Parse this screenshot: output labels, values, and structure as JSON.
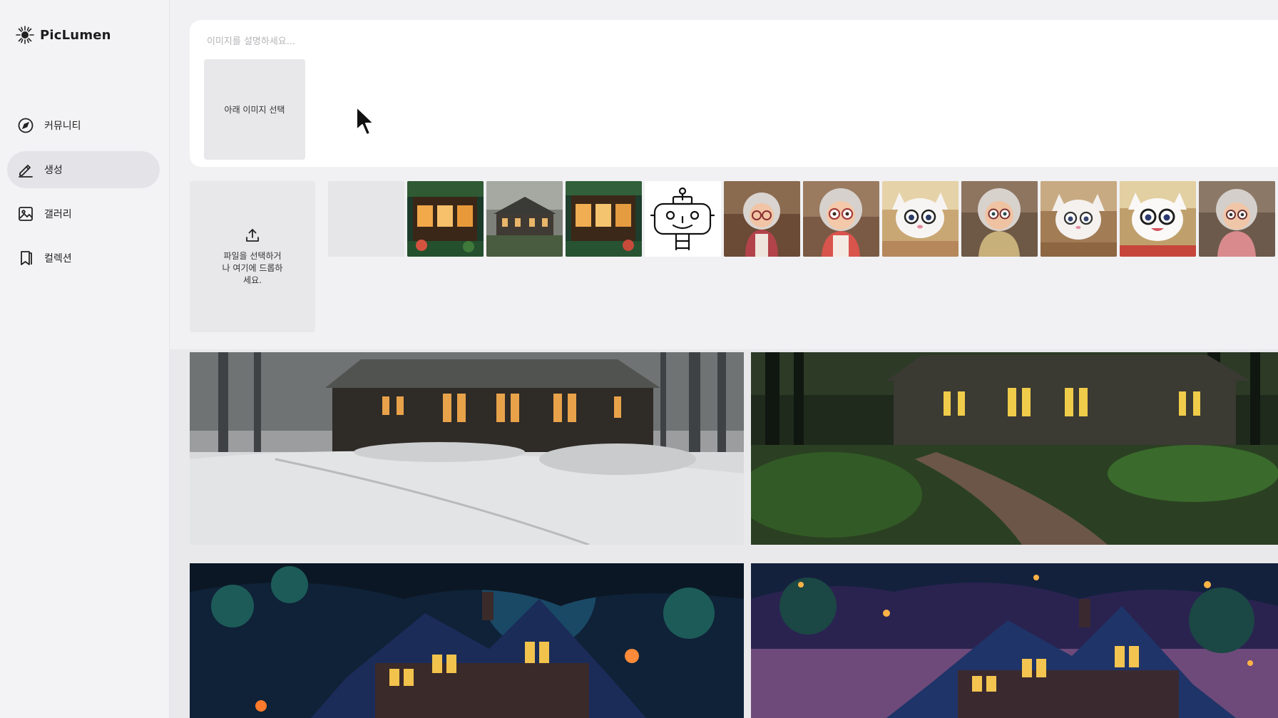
{
  "app": {
    "name": "PicLumen"
  },
  "sidebar": {
    "items": [
      {
        "label": "커뮤니티",
        "icon": "compass-icon"
      },
      {
        "label": "생성",
        "icon": "pen-icon",
        "active": true
      },
      {
        "label": "갤러리",
        "icon": "image-icon"
      },
      {
        "label": "컬렉션",
        "icon": "bookmark-icon"
      }
    ]
  },
  "prompt": {
    "placeholder": "이미지를 설명하세요...",
    "value": "",
    "select_image_label": "아래 이미지 선택"
  },
  "uploader": {
    "icon": "upload-icon",
    "text": "파일을 선택하거\n나 여기에 드롭하\n세요."
  },
  "colors": {
    "sidebar_bg": "#f3f3f5",
    "active_bg": "#e4e4e8",
    "card_bg": "#ffffff"
  }
}
